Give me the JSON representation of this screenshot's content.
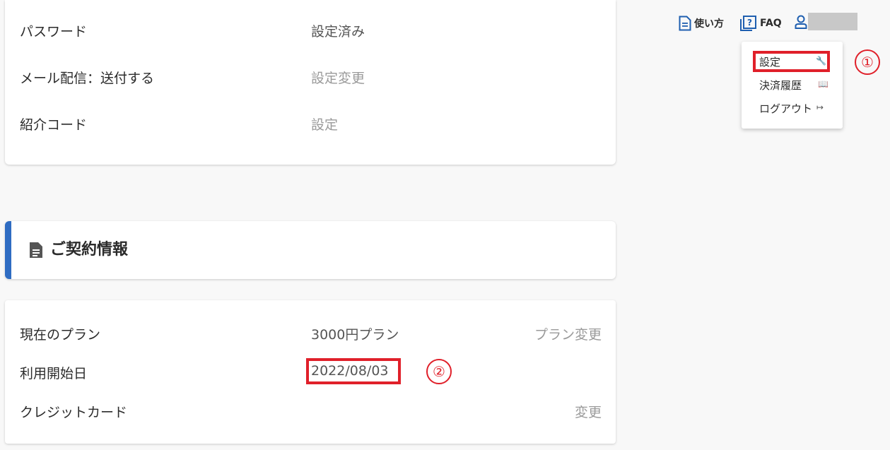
{
  "account": {
    "rows": [
      {
        "label": "パスワード",
        "value": "設定済み"
      },
      {
        "label": "メール配信：送付する",
        "value": "設定変更"
      },
      {
        "label": "紹介コード",
        "value": "設定"
      }
    ]
  },
  "contract": {
    "title": "ご契約情報",
    "rows": [
      {
        "label": "現在のプラン",
        "value": "3000円プラン",
        "action": "プラン変更"
      },
      {
        "label": "利用開始日",
        "value": "2022/08/03"
      },
      {
        "label": "クレジットカード",
        "action": "変更"
      }
    ]
  },
  "topnav": {
    "howto": "使い方",
    "faq": "FAQ"
  },
  "menu": {
    "items": [
      {
        "label": "設定",
        "icon": "wrench-icon"
      },
      {
        "label": "決済履歴",
        "icon": "receipt-icon"
      },
      {
        "label": "ログアウト",
        "icon": "logout-icon"
      }
    ]
  },
  "annotations": {
    "one": "①",
    "two": "②"
  },
  "colors": {
    "accent": "#2f6cc2",
    "annotation_red": "#e0202a",
    "icon_blue": "#1f5fb0"
  }
}
